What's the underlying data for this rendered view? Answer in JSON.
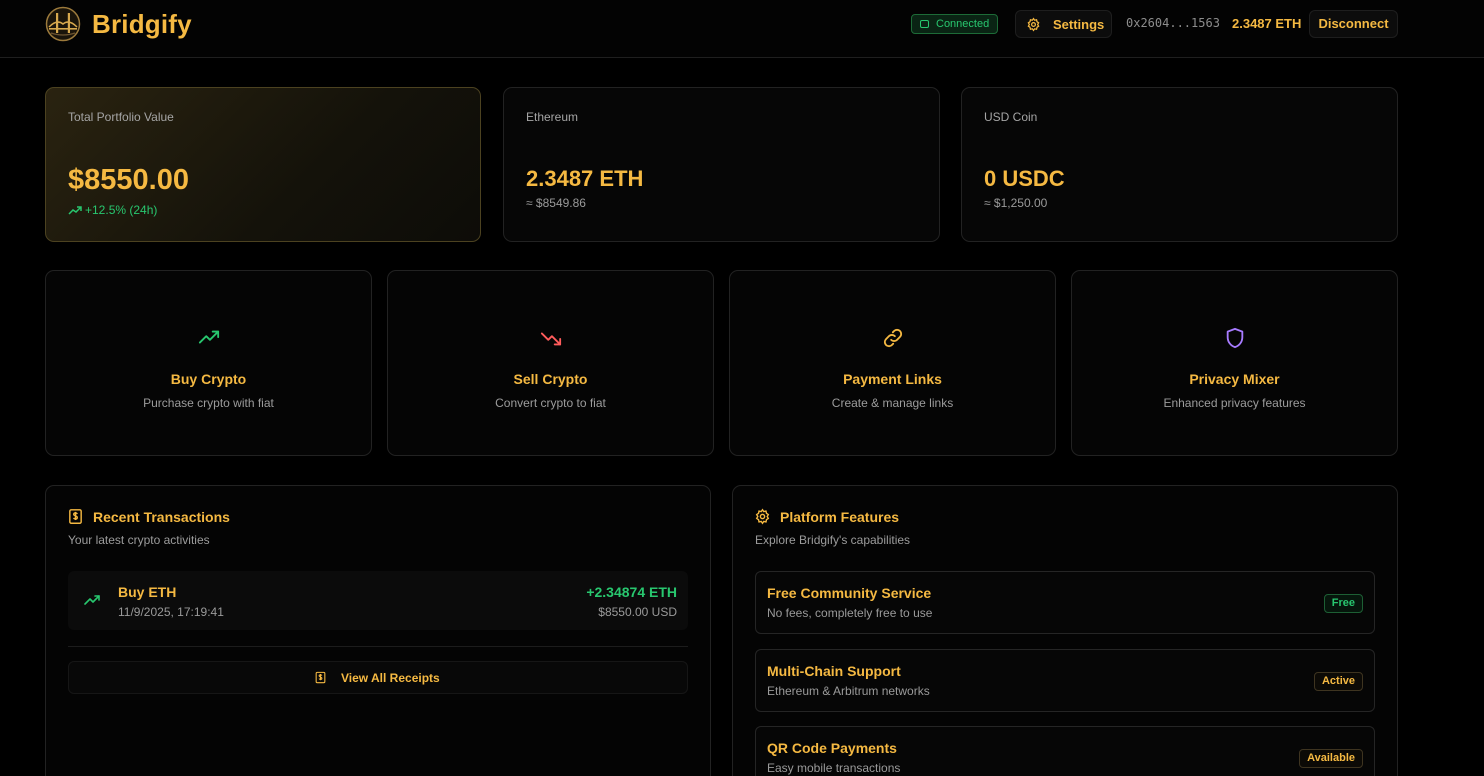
{
  "header": {
    "brand": "Bridgify",
    "status": "Connected",
    "settings_label": "Settings",
    "address": "0x2604...1563",
    "balance": "2.3487 ETH",
    "disconnect_label": "Disconnect"
  },
  "stats": [
    {
      "label": "Total Portfolio Value",
      "value": "$8550.00",
      "change": "+12.5% (24h)"
    },
    {
      "label": "Ethereum",
      "value": "2.3487 ETH",
      "sub": "≈ $8549.86"
    },
    {
      "label": "USD Coin",
      "value": "0 USDC",
      "sub": "≈ $1,250.00"
    }
  ],
  "actions": [
    {
      "title": "Buy Crypto",
      "subtitle": "Purchase crypto with fiat",
      "icon": "trending-up-icon",
      "color": "#28c76f"
    },
    {
      "title": "Sell Crypto",
      "subtitle": "Convert crypto to fiat",
      "icon": "trending-down-icon",
      "color": "#ff5c5c"
    },
    {
      "title": "Payment Links",
      "subtitle": "Create & manage links",
      "icon": "link-icon",
      "color": "#f5b942"
    },
    {
      "title": "Privacy Mixer",
      "subtitle": "Enhanced privacy features",
      "icon": "shield-icon",
      "color": "#a77bff"
    }
  ],
  "transactions": {
    "title": "Recent Transactions",
    "subtitle": "Your latest crypto activities",
    "items": [
      {
        "type": "Buy ETH",
        "date": "11/9/2025, 17:19:41",
        "amount": "+2.34874 ETH",
        "usd": "$8550.00 USD"
      }
    ],
    "view_all_label": "View All Receipts"
  },
  "features": {
    "title": "Platform Features",
    "subtitle": "Explore Bridgify's capabilities",
    "items": [
      {
        "title": "Free Community Service",
        "subtitle": "No fees, completely free to use",
        "badge": "Free"
      },
      {
        "title": "Multi-Chain Support",
        "subtitle": "Ethereum & Arbitrum networks",
        "badge": "Active"
      },
      {
        "title": "QR Code Payments",
        "subtitle": "Easy mobile transactions",
        "badge": "Available"
      }
    ]
  },
  "colors": {
    "accent": "#f5b942",
    "positive": "#28c76f",
    "negative": "#ff5c5c",
    "privacy": "#a77bff",
    "background": "#000000"
  }
}
